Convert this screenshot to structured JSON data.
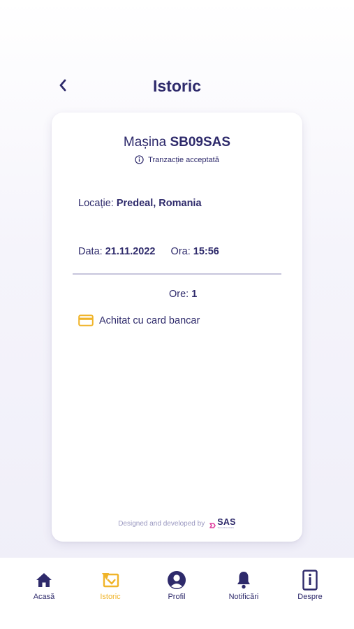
{
  "header": {
    "title": "Istoric",
    "back_icon": "chevron-left-icon"
  },
  "card": {
    "car_prefix": "Mașina",
    "car_plate": "SB09SAS",
    "status_icon": "info-icon",
    "status_text": "Tranzacție acceptată",
    "location_label": "Locație:",
    "location_value": "Predeal, Romania",
    "date_label": "Data:",
    "date_value": "21.11.2022",
    "time_label": "Ora:",
    "time_value": "15:56",
    "hours_label": "Ore:",
    "hours_value": "1",
    "payment_icon": "credit-card-icon",
    "payment_text": "Achitat cu card bancar",
    "credit_text": "Designed and developed by",
    "credit_logo_text": "SAS",
    "credit_logo_subtext": "TECHNOLOGIES"
  },
  "nav": {
    "items": [
      {
        "label": "Acasă",
        "icon": "home-icon",
        "active": false
      },
      {
        "label": "Istoric",
        "icon": "history-icon",
        "active": true
      },
      {
        "label": "Profil",
        "icon": "profile-icon",
        "active": false
      },
      {
        "label": "Notificări",
        "icon": "bell-icon",
        "active": false
      },
      {
        "label": "Despre",
        "icon": "about-icon",
        "active": false
      }
    ]
  },
  "colors": {
    "primary": "#2e2a6b",
    "accent": "#f0b429",
    "divider": "#c7c5dc",
    "logo_pink": "#e040a0"
  }
}
